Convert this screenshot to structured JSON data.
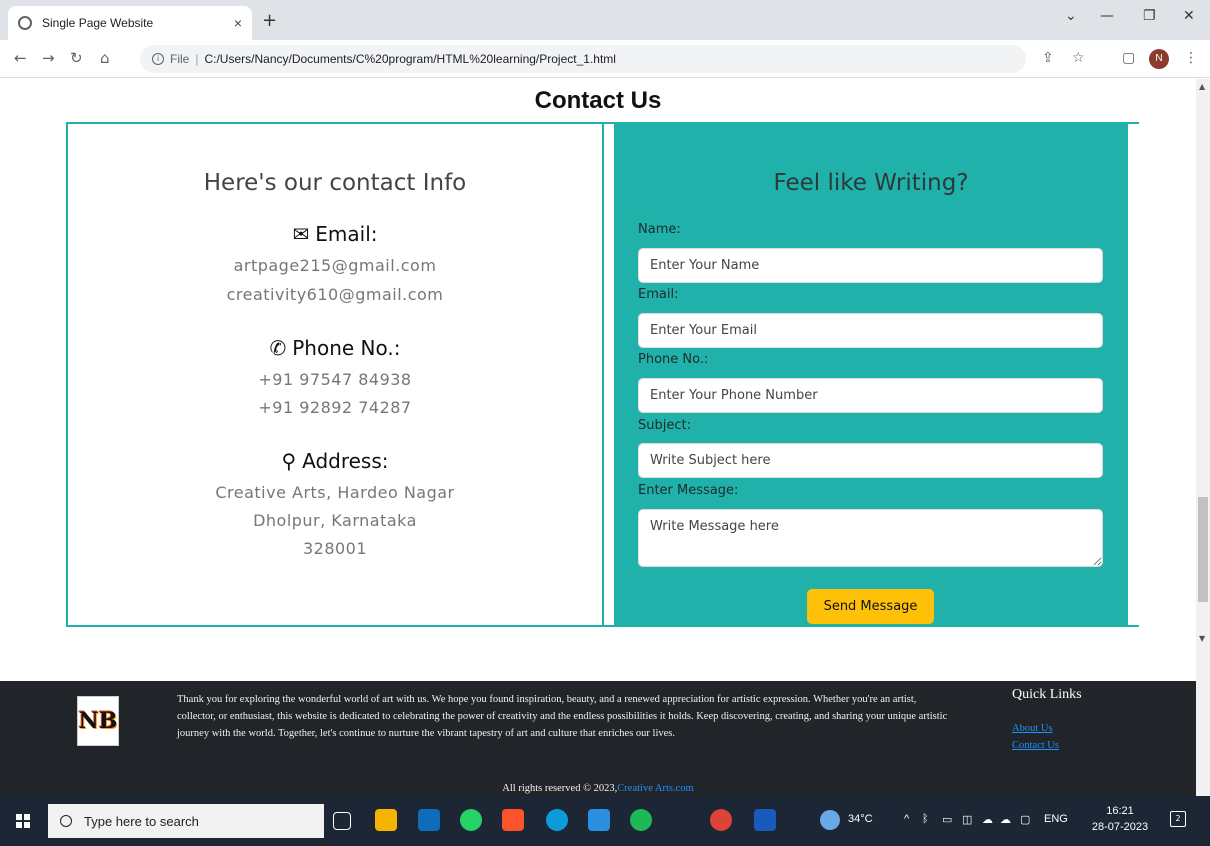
{
  "browser": {
    "tab_title": "Single Page Website",
    "tab_close": "×",
    "new_tab": "+",
    "address_prefix": "File",
    "address_sep": "|",
    "url": "C:/Users/Nancy/Documents/C%20program/HTML%20learning/Project_1.html",
    "avatar_letter": "N",
    "win_min": "—",
    "win_restore": "❐",
    "win_close": "✕"
  },
  "contact": {
    "section_title": "Contact Us",
    "info": {
      "heading": "Here's our contact Info",
      "email_label": "Email:",
      "emails": [
        "artpage215@gmail.com",
        "creativity610@gmail.com"
      ],
      "phone_label": "Phone No.:",
      "phones": [
        "+91 97547 84938",
        "+91 92892 74287"
      ],
      "address_label": "Address:",
      "address_lines": [
        "Creative Arts, Hardeo Nagar",
        "Dholpur, Karnataka",
        "328001"
      ]
    },
    "form": {
      "heading": "Feel like Writing?",
      "name_label": "Name:",
      "name_placeholder": "Enter Your Name",
      "email_label": "Email:",
      "email_placeholder": "Enter Your Email",
      "phone_label": "Phone No.:",
      "phone_placeholder": "Enter Your Phone Number",
      "subject_label": "Subject:",
      "subject_placeholder": "Write Subject here",
      "message_label": "Enter Message:",
      "message_placeholder": "Write Message here",
      "submit_label": "Send Message"
    }
  },
  "footer": {
    "logo_text": "NB",
    "text": "Thank you for exploring the wonderful world of art with us. We hope you found inspiration, beauty, and a renewed appreciation for artistic expression. Whether you're an artist, collector, or enthusiast, this website is dedicated to celebrating the power of creativity and the endless possibilities it holds. Keep discovering, creating, and sharing your unique artistic journey with the world. Together, let's continue to nurture the vibrant tapestry of art and culture that enriches our lives.",
    "quick_links_title": "Quick Links",
    "links": [
      "About Us",
      "Contact Us"
    ],
    "rights_text": "All rights reserved © 2023,",
    "rights_link": "Creative Arts.com"
  },
  "taskbar": {
    "search_placeholder": "Type here to search",
    "weather": "34°C",
    "language": "ENG",
    "time": "16:21",
    "date": "28-07-2023",
    "notification_count": "2"
  },
  "colors": {
    "accent": "#20b2aa",
    "button": "#ffc107",
    "footer_bg": "#212529",
    "link": "#1e90ff"
  }
}
